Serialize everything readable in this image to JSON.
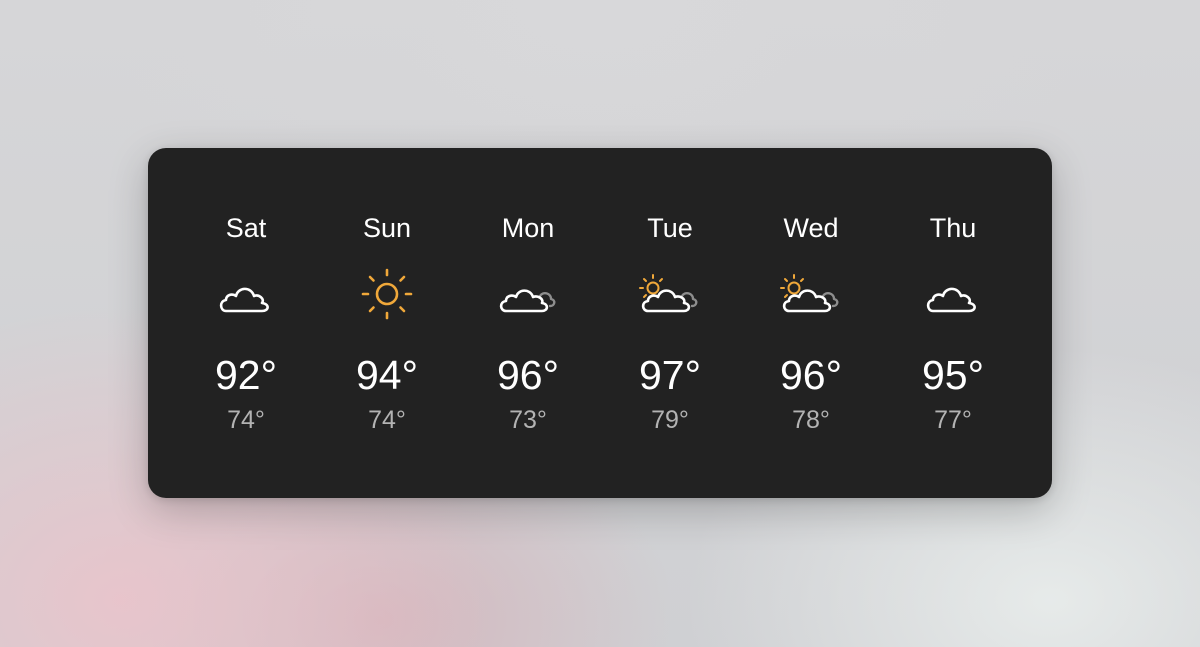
{
  "forecast": {
    "days": [
      {
        "day": "Sat",
        "condition": "cloud-icon",
        "high": "92°",
        "low": "74°"
      },
      {
        "day": "Sun",
        "condition": "sun-icon",
        "high": "94°",
        "low": "74°"
      },
      {
        "day": "Mon",
        "condition": "cloudy-icon",
        "high": "96°",
        "low": "73°"
      },
      {
        "day": "Tue",
        "condition": "partly-cloudy-icon",
        "high": "97°",
        "low": "79°"
      },
      {
        "day": "Wed",
        "condition": "partly-cloudy-icon",
        "high": "96°",
        "low": "78°"
      },
      {
        "day": "Thu",
        "condition": "cloud-icon",
        "high": "95°",
        "low": "77°"
      }
    ]
  },
  "colors": {
    "widget_background": "#222222",
    "primary_text": "#ffffff",
    "secondary_text": "#b3b3b3",
    "sun": "#f0a83a",
    "cloud": "#ffffff",
    "cloud_back": "#8e8e8e"
  }
}
